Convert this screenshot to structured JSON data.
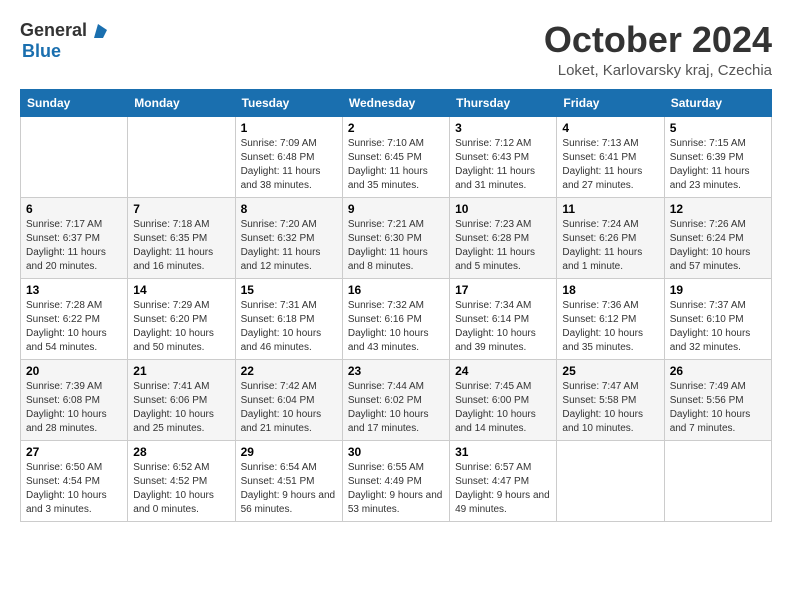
{
  "header": {
    "logo_general": "General",
    "logo_blue": "Blue",
    "month_title": "October 2024",
    "location": "Loket, Karlovarsky kraj, Czechia"
  },
  "weekdays": [
    "Sunday",
    "Monday",
    "Tuesday",
    "Wednesday",
    "Thursday",
    "Friday",
    "Saturday"
  ],
  "weeks": [
    [
      {
        "day": "",
        "detail": ""
      },
      {
        "day": "",
        "detail": ""
      },
      {
        "day": "1",
        "detail": "Sunrise: 7:09 AM\nSunset: 6:48 PM\nDaylight: 11 hours and 38 minutes."
      },
      {
        "day": "2",
        "detail": "Sunrise: 7:10 AM\nSunset: 6:45 PM\nDaylight: 11 hours and 35 minutes."
      },
      {
        "day": "3",
        "detail": "Sunrise: 7:12 AM\nSunset: 6:43 PM\nDaylight: 11 hours and 31 minutes."
      },
      {
        "day": "4",
        "detail": "Sunrise: 7:13 AM\nSunset: 6:41 PM\nDaylight: 11 hours and 27 minutes."
      },
      {
        "day": "5",
        "detail": "Sunrise: 7:15 AM\nSunset: 6:39 PM\nDaylight: 11 hours and 23 minutes."
      }
    ],
    [
      {
        "day": "6",
        "detail": "Sunrise: 7:17 AM\nSunset: 6:37 PM\nDaylight: 11 hours and 20 minutes."
      },
      {
        "day": "7",
        "detail": "Sunrise: 7:18 AM\nSunset: 6:35 PM\nDaylight: 11 hours and 16 minutes."
      },
      {
        "day": "8",
        "detail": "Sunrise: 7:20 AM\nSunset: 6:32 PM\nDaylight: 11 hours and 12 minutes."
      },
      {
        "day": "9",
        "detail": "Sunrise: 7:21 AM\nSunset: 6:30 PM\nDaylight: 11 hours and 8 minutes."
      },
      {
        "day": "10",
        "detail": "Sunrise: 7:23 AM\nSunset: 6:28 PM\nDaylight: 11 hours and 5 minutes."
      },
      {
        "day": "11",
        "detail": "Sunrise: 7:24 AM\nSunset: 6:26 PM\nDaylight: 11 hours and 1 minute."
      },
      {
        "day": "12",
        "detail": "Sunrise: 7:26 AM\nSunset: 6:24 PM\nDaylight: 10 hours and 57 minutes."
      }
    ],
    [
      {
        "day": "13",
        "detail": "Sunrise: 7:28 AM\nSunset: 6:22 PM\nDaylight: 10 hours and 54 minutes."
      },
      {
        "day": "14",
        "detail": "Sunrise: 7:29 AM\nSunset: 6:20 PM\nDaylight: 10 hours and 50 minutes."
      },
      {
        "day": "15",
        "detail": "Sunrise: 7:31 AM\nSunset: 6:18 PM\nDaylight: 10 hours and 46 minutes."
      },
      {
        "day": "16",
        "detail": "Sunrise: 7:32 AM\nSunset: 6:16 PM\nDaylight: 10 hours and 43 minutes."
      },
      {
        "day": "17",
        "detail": "Sunrise: 7:34 AM\nSunset: 6:14 PM\nDaylight: 10 hours and 39 minutes."
      },
      {
        "day": "18",
        "detail": "Sunrise: 7:36 AM\nSunset: 6:12 PM\nDaylight: 10 hours and 35 minutes."
      },
      {
        "day": "19",
        "detail": "Sunrise: 7:37 AM\nSunset: 6:10 PM\nDaylight: 10 hours and 32 minutes."
      }
    ],
    [
      {
        "day": "20",
        "detail": "Sunrise: 7:39 AM\nSunset: 6:08 PM\nDaylight: 10 hours and 28 minutes."
      },
      {
        "day": "21",
        "detail": "Sunrise: 7:41 AM\nSunset: 6:06 PM\nDaylight: 10 hours and 25 minutes."
      },
      {
        "day": "22",
        "detail": "Sunrise: 7:42 AM\nSunset: 6:04 PM\nDaylight: 10 hours and 21 minutes."
      },
      {
        "day": "23",
        "detail": "Sunrise: 7:44 AM\nSunset: 6:02 PM\nDaylight: 10 hours and 17 minutes."
      },
      {
        "day": "24",
        "detail": "Sunrise: 7:45 AM\nSunset: 6:00 PM\nDaylight: 10 hours and 14 minutes."
      },
      {
        "day": "25",
        "detail": "Sunrise: 7:47 AM\nSunset: 5:58 PM\nDaylight: 10 hours and 10 minutes."
      },
      {
        "day": "26",
        "detail": "Sunrise: 7:49 AM\nSunset: 5:56 PM\nDaylight: 10 hours and 7 minutes."
      }
    ],
    [
      {
        "day": "27",
        "detail": "Sunrise: 6:50 AM\nSunset: 4:54 PM\nDaylight: 10 hours and 3 minutes."
      },
      {
        "day": "28",
        "detail": "Sunrise: 6:52 AM\nSunset: 4:52 PM\nDaylight: 10 hours and 0 minutes."
      },
      {
        "day": "29",
        "detail": "Sunrise: 6:54 AM\nSunset: 4:51 PM\nDaylight: 9 hours and 56 minutes."
      },
      {
        "day": "30",
        "detail": "Sunrise: 6:55 AM\nSunset: 4:49 PM\nDaylight: 9 hours and 53 minutes."
      },
      {
        "day": "31",
        "detail": "Sunrise: 6:57 AM\nSunset: 4:47 PM\nDaylight: 9 hours and 49 minutes."
      },
      {
        "day": "",
        "detail": ""
      },
      {
        "day": "",
        "detail": ""
      }
    ]
  ]
}
